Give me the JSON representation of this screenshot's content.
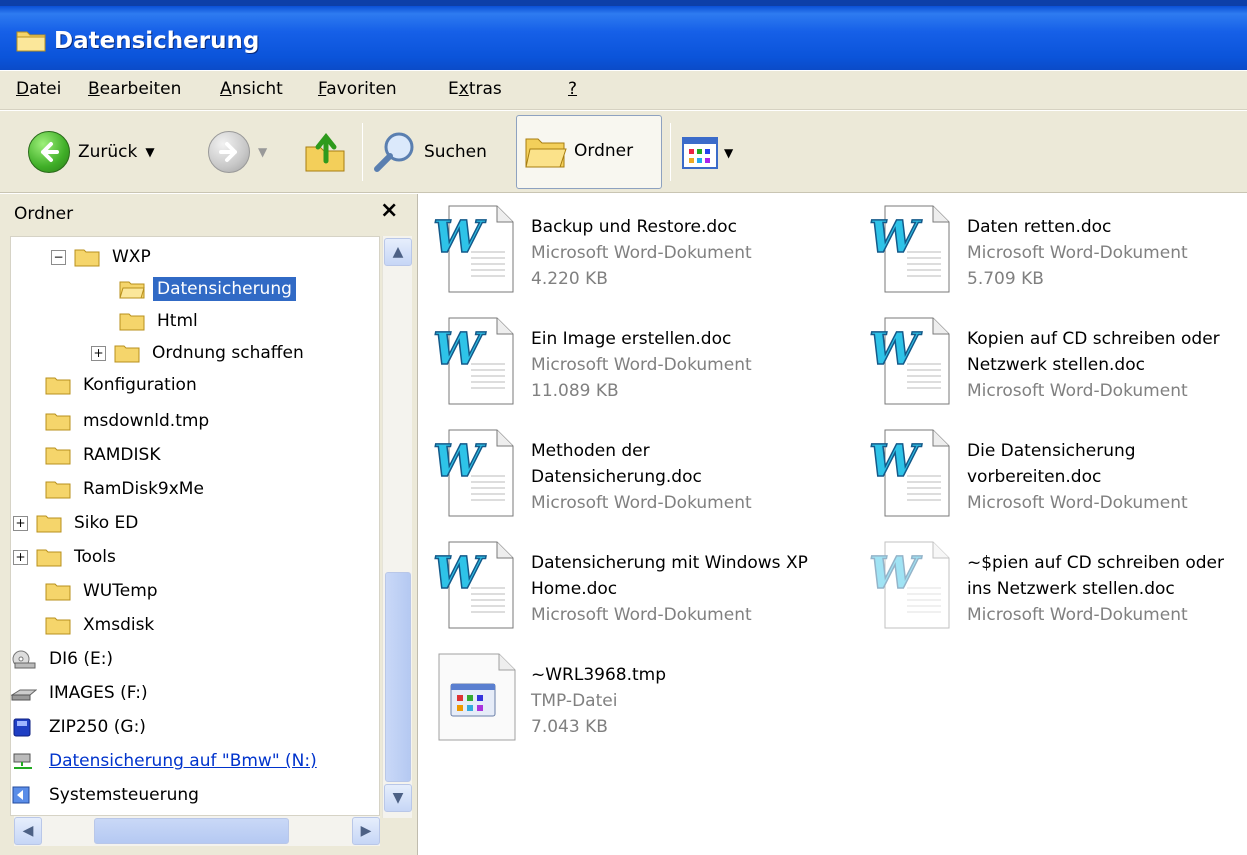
{
  "window": {
    "title": "Datensicherung"
  },
  "menu": [
    "Datei",
    "Bearbeiten",
    "Ansicht",
    "Favoriten",
    "Extras",
    "?"
  ],
  "toolbar": {
    "back_label": "Zurück",
    "search_label": "Suchen",
    "folders_label": "Ordner"
  },
  "folders_pane": {
    "header": "Ordner",
    "close": "×",
    "items": [
      {
        "label": "WXP",
        "expander": "⊟"
      },
      {
        "label": "Datensicherung",
        "selected": true
      },
      {
        "label": "Html"
      },
      {
        "label": "Ordnung schaffen",
        "expander": "⊞"
      },
      {
        "label": "Konfiguration"
      },
      {
        "label": "msdownld.tmp"
      },
      {
        "label": "RAMDISK"
      },
      {
        "label": "RamDisk9xMe"
      },
      {
        "label": "Siko ED",
        "expander": "⊞"
      },
      {
        "label": "Tools",
        "expander": "⊞"
      },
      {
        "label": "WUTemp"
      },
      {
        "label": "Xmsdisk"
      },
      {
        "label": "DI6 (E:)",
        "icon": "cd-drive-icon"
      },
      {
        "label": "IMAGES (F:)",
        "icon": "drive-icon"
      },
      {
        "label": "ZIP250 (G:)",
        "icon": "zip-drive-icon"
      },
      {
        "label": "Datensicherung auf \"Bmw\" (N:)",
        "icon": "network-drive-icon"
      },
      {
        "label": "Systemsteuerung",
        "icon": "control-panel-icon"
      }
    ]
  },
  "files": [
    {
      "name": "Backup und Restore.doc",
      "type": "Microsoft Word-Dokument",
      "size": "4.220 KB"
    },
    {
      "name": "Daten retten.doc",
      "type": "Microsoft Word-Dokument",
      "size": "5.709 KB"
    },
    {
      "name_line1": "Ein Image erstellen.doc",
      "type": "Microsoft Word-Dokument",
      "size": "11.089 KB"
    },
    {
      "name_line1": "Kopien auf CD schreiben oder",
      "name_line2": "Netzwerk stellen.doc",
      "type": "Microsoft Word-Dokument"
    },
    {
      "name_line1": "Methoden der",
      "name_line2": "Datensicherung.doc",
      "type": "Microsoft Word-Dokument"
    },
    {
      "name_line1": "Die Datensicherung",
      "name_line2": "vorbereiten.doc",
      "type": "Microsoft Word-Dokument"
    },
    {
      "name_line1": "Datensicherung mit Windows XP",
      "name_line2": "Home.doc",
      "type": "Microsoft Word-Dokument"
    },
    {
      "name_line1": "~$pien auf CD schreiben oder",
      "name_line2": "ins Netzwerk stellen.doc",
      "type": "Microsoft Word-Dokument"
    },
    {
      "name": "~WRL3968.tmp",
      "type": "TMP-Datei",
      "size": "7.043 KB"
    }
  ]
}
